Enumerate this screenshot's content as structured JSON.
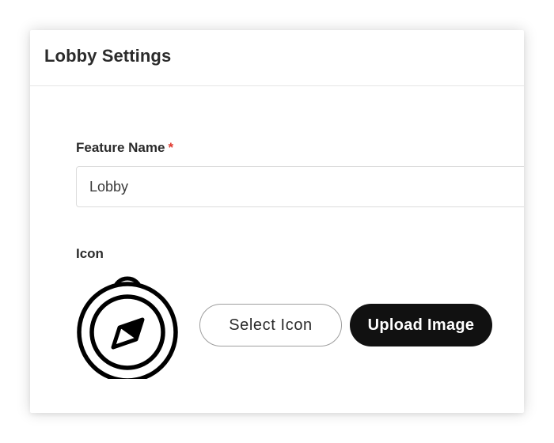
{
  "header": {
    "title": "Lobby Settings"
  },
  "form": {
    "feature_name_label": "Feature Name",
    "required_marker": "*",
    "feature_name_value": "Lobby",
    "icon_label": "Icon",
    "icon_name": "compass-icon"
  },
  "actions": {
    "select_icon_label": "Select Icon",
    "upload_image_label": "Upload Image"
  },
  "colors": {
    "required": "#e0392f",
    "primary_button_bg": "#111111",
    "primary_button_text": "#ffffff"
  }
}
